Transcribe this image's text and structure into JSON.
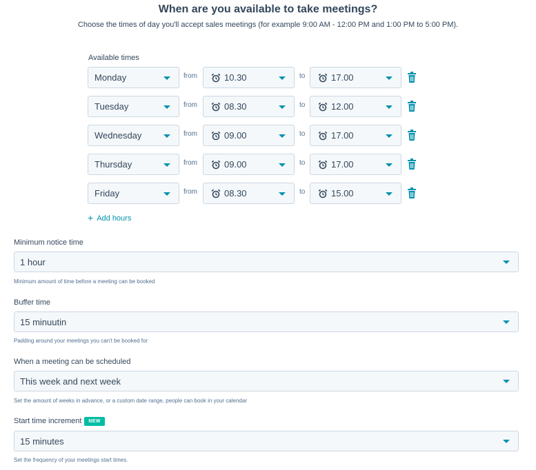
{
  "header": {
    "title": "When are you available to take meetings?",
    "subtitle": "Choose the times of day you'll accept sales meetings (for example 9:00 AM - 12:00 PM and 1:00 PM to 5:00 PM)."
  },
  "availability": {
    "label": "Available times",
    "from_label": "from",
    "to_label": "to",
    "rows": [
      {
        "day": "Monday",
        "start": "10.30",
        "end": "17.00"
      },
      {
        "day": "Tuesday",
        "start": "08.30",
        "end": "12.00"
      },
      {
        "day": "Wednesday",
        "start": "09.00",
        "end": "17.00"
      },
      {
        "day": "Thursday",
        "start": "09.00",
        "end": "17.00"
      },
      {
        "day": "Friday",
        "start": "08.30",
        "end": "15.00"
      }
    ],
    "add_hours_label": "Add hours"
  },
  "settings": {
    "min_notice": {
      "label": "Minimum notice time",
      "value": "1 hour",
      "help": "Minimum amount of time before a meeting can be booked"
    },
    "buffer": {
      "label": "Buffer time",
      "value": "15 minuutin",
      "help": "Padding around your meetings you can't be booked for"
    },
    "schedule_window": {
      "label": "When a meeting can be scheduled",
      "value": "This week and next week",
      "help": "Set the amount of weeks in advance, or a custom date range, people can book in your calendar"
    },
    "start_increment": {
      "label": "Start time increment",
      "badge": "NEW",
      "value": "15 minutes",
      "help": "Set the frequency of your meetings start times."
    }
  },
  "colors": {
    "accent": "#0091ae",
    "badge": "#00bda5",
    "text": "#33475b",
    "field_bg": "#f5f8fa",
    "border": "#cbd6e2"
  },
  "icons": {
    "time": "alarm-clock-icon",
    "delete": "trash-icon",
    "add": "plus-icon",
    "dropdown": "caret-down-icon"
  }
}
